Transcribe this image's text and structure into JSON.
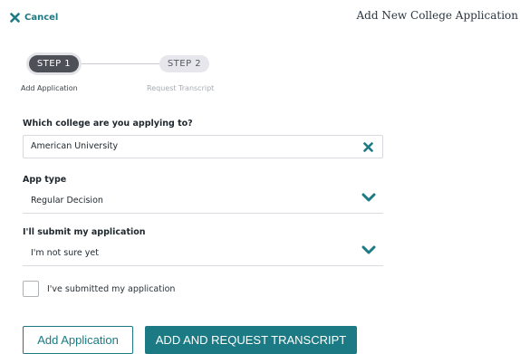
{
  "header": {
    "cancel_label": "Cancel",
    "title": "Add New College Application"
  },
  "stepper": {
    "steps": [
      {
        "pill": "STEP 1",
        "label": "Add Application",
        "active": true
      },
      {
        "pill": "STEP 2",
        "label": "Request Transcript",
        "active": false
      }
    ]
  },
  "form": {
    "college": {
      "label": "Which college are you applying to?",
      "value": "American University"
    },
    "app_type": {
      "label": "App type",
      "value": "Regular Decision"
    },
    "submit_plan": {
      "label": "I'll submit my application",
      "value": "I'm not sure yet"
    },
    "submitted_checkbox": {
      "label": "I've submitted my application",
      "checked": false
    }
  },
  "actions": {
    "secondary_label": "Add Application",
    "primary_label": "ADD AND REQUEST TRANSCRIPT"
  },
  "icons": {
    "cancel": "close-icon",
    "clear": "clear-icon",
    "dropdown": "chevron-down-icon"
  },
  "colors": {
    "accent": "#1b7a83",
    "step_active": "#4d5057",
    "step_inactive": "#e6e6ec"
  }
}
